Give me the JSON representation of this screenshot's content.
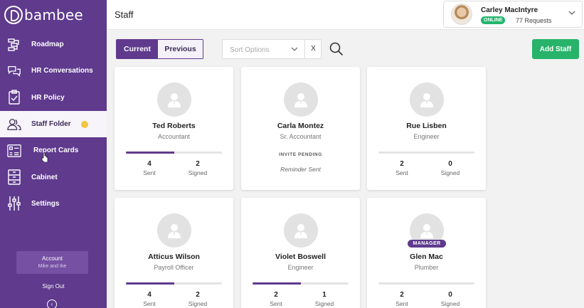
{
  "app": {
    "logo": "bambee"
  },
  "sidebar": {
    "items": [
      {
        "label": "Roadmap",
        "icon": "roadmap-icon"
      },
      {
        "label": "HR Conversations",
        "icon": "chat-icon"
      },
      {
        "label": "HR Policy",
        "icon": "clipboard-check-icon"
      },
      {
        "label": "Staff Folder",
        "icon": "staff-icon",
        "active": true
      },
      {
        "label": "Report Cards",
        "icon": "report-card-icon"
      },
      {
        "label": "Cabinet",
        "icon": "cabinet-icon"
      },
      {
        "label": "Settings",
        "icon": "sliders-icon"
      }
    ],
    "account_label": "Account",
    "account_name": "Mike and Ike",
    "sign_out": "Sign Out"
  },
  "header": {
    "title": "Staff",
    "user": {
      "name": "Carley MacIntyre",
      "status": "ONLINE",
      "requests": "77 Requests"
    }
  },
  "toolbar": {
    "tab_current": "Current",
    "tab_previous": "Previous",
    "sort_placeholder": "Sort Options",
    "clear_label": "X",
    "add_staff": "Add Staff"
  },
  "labels": {
    "sent": "Sent",
    "signed": "Signed",
    "invite_pending": "INVITE PENDING",
    "reminder_sent": "Reminder Sent",
    "manager": "MANAGER"
  },
  "staff": [
    {
      "name": "Ted Roberts",
      "title": "Accountant",
      "sent": "4",
      "signed": "2",
      "progress": 0.5
    },
    {
      "name": "Carla Montez",
      "title": "Sr. Accountant",
      "pending": true
    },
    {
      "name": "Rue Lisben",
      "title": "Engineer",
      "sent": "2",
      "signed": "0",
      "progress": 0
    },
    {
      "name": "Atticus Wilson",
      "title": "Payroll Officer",
      "sent": "4",
      "signed": "2",
      "progress": 0.5
    },
    {
      "name": "Violet Boswell",
      "title": "Engineer",
      "sent": "2",
      "signed": "1",
      "progress": 0.5
    },
    {
      "name": "Glen Mac",
      "title": "Plumber",
      "sent": "2",
      "signed": "0",
      "progress": 0,
      "manager": true
    }
  ],
  "colors": {
    "brand": "#5f3a8d",
    "success": "#27b36a",
    "notification": "#f4c542"
  }
}
